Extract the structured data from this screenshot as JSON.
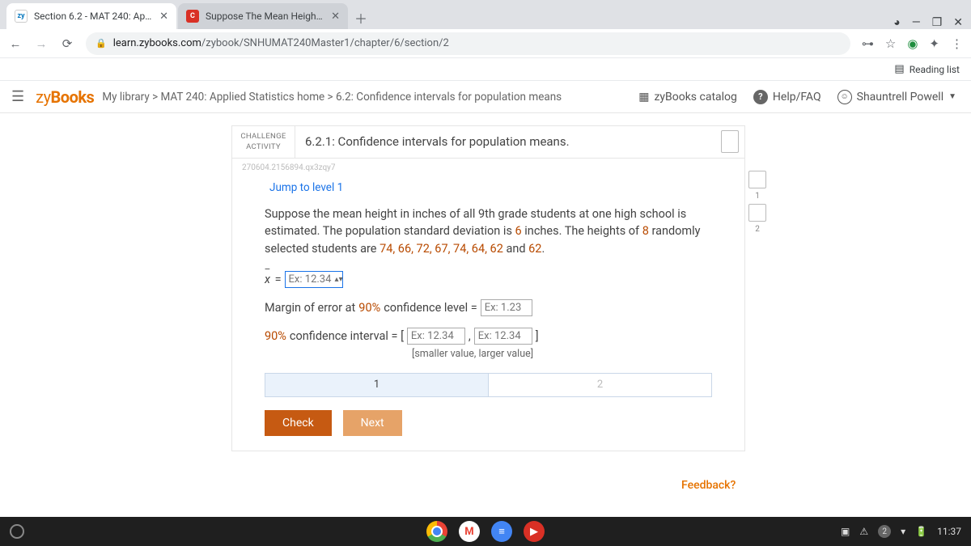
{
  "tabs": [
    {
      "favicon": "zy",
      "title": "Section 6.2 - MAT 240: Applied S"
    },
    {
      "favicon": "C",
      "title": "Suppose The Mean Height In Inc"
    }
  ],
  "url": {
    "host": "learn.zybooks.com",
    "path": "/zybook/SNHUMAT240Master1/chapter/6/section/2"
  },
  "reading_list": "Reading list",
  "zy": {
    "logo_a": "zy",
    "logo_b": "Books",
    "crumbs": "My library > MAT 240: Applied Statistics home > 6.2: Confidence intervals for population means",
    "catalog": "zyBooks catalog",
    "help": "Help/FAQ",
    "user": "Shauntrell Powell"
  },
  "card": {
    "badge1": "CHALLENGE",
    "badge2": "ACTIVITY",
    "title": "6.2.1: Confidence intervals for population means.",
    "hash": "270604.2156894.qx3zqy7",
    "jump": "Jump to level 1"
  },
  "levels": {
    "l1": "1",
    "l2": "2"
  },
  "prompt": {
    "p1": "Suppose the mean height in inches of all 9th grade students at one high school is estimated. The population standard deviation is ",
    "sd": "6",
    "p2": " inches. The heights of ",
    "n": "8",
    "p3": " randomly selected students are ",
    "vals": "74, 66, 72, 67, 74, 64, 62",
    "p4": " and ",
    "last": "62",
    "p5": "."
  },
  "rows": {
    "xbar_label": "x̄ = ",
    "xbar_ph": "Ex: 12.34",
    "me_label_a": "Margin of error at ",
    "me_pct": "90%",
    "me_label_b": " confidence level = ",
    "me_ph": "Ex: 1.23",
    "ci_label_a": "90%",
    "ci_label_b": " confidence interval = [ ",
    "ci_ph1": "Ex: 12.34",
    "ci_sep": " , ",
    "ci_ph2": "Ex: 12.34",
    "ci_close": " ]",
    "ci_hint": "[smaller value, larger value]"
  },
  "steps": {
    "s1": "1",
    "s2": "2"
  },
  "btns": {
    "check": "Check",
    "next": "Next"
  },
  "feedback": "Feedback?",
  "taskbar": {
    "warn": "⚠",
    "badge": "2",
    "wifi": "▾",
    "batt": "🔋",
    "time": "11:37"
  }
}
